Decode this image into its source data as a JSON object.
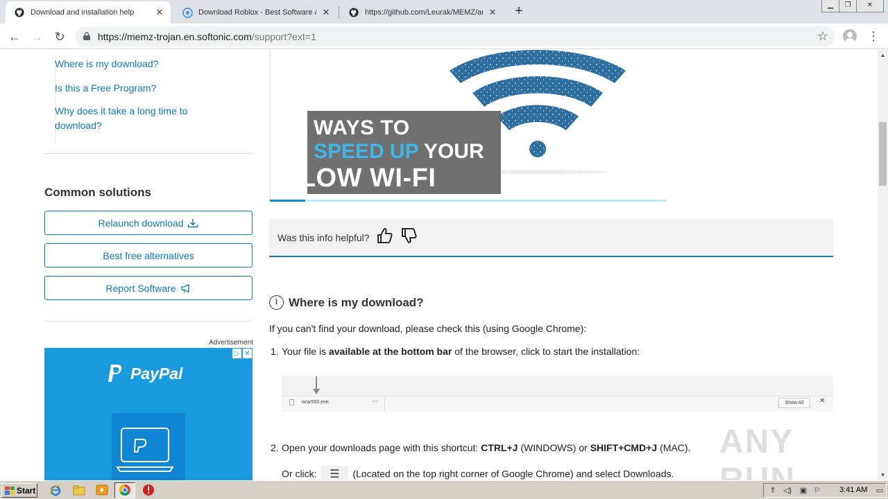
{
  "browser": {
    "tabs": [
      {
        "label": "Download and installation help",
        "active": true
      },
      {
        "label": "Download Roblox - Best Software &",
        "active": false
      },
      {
        "label": "https://github.com/Leurak/MEMZ/ar",
        "active": false
      }
    ],
    "url_host": "https://memz-trojan.en.softonic.com",
    "url_path": "/support?ext=1"
  },
  "sidebar": {
    "links": [
      "Where is my download?",
      "Is this a Free Program?",
      "Why does it take a long time to",
      "download?"
    ],
    "common_heading": "Common solutions",
    "buttons": {
      "relaunch": "Relaunch download",
      "alternatives": "Best free alternatives",
      "report": "Report Software"
    },
    "ad_label": "Advertisement",
    "ad_brand": "PayPal"
  },
  "hero": {
    "line1": "WAYS TO",
    "line2_highlight": "SPEED UP",
    "line2_rest": " YOUR",
    "line3": "SLOW WI-FI",
    "progress": 0.09
  },
  "helpful": {
    "question": "Was this info helpful?"
  },
  "section": {
    "title": "Where is my download?",
    "intro": "If you can't find your download, please check this (using Google Chrome):",
    "step1_num": "1.",
    "step1_pre": "Your file is ",
    "step1_bold": "available at the bottom bar",
    "step1_post": " of the browser, click to start the installation:",
    "download_bar": {
      "file": "wrar550.exe",
      "show_all": "Show All"
    },
    "step2_num": "2.",
    "step2_pre": "Open your downloads page with this shortcut: ",
    "step2_key1": "CTRL+J",
    "step2_mid": " (WINDOWS) or ",
    "step2_key2": "SHIFT+CMD+J",
    "step2_post": " (MAC).",
    "step2b_pre": "Or click: ",
    "step2b_post": " (Located on the top right corner of Google Chrome) and select Downloads."
  },
  "watermark": "ANY RUN",
  "taskbar": {
    "start": "Start",
    "clock": "3:41 AM"
  },
  "colors": {
    "link": "#1178b4",
    "hero_highlight": "#3fb6e8",
    "ad_bg": "#1a9be0"
  }
}
